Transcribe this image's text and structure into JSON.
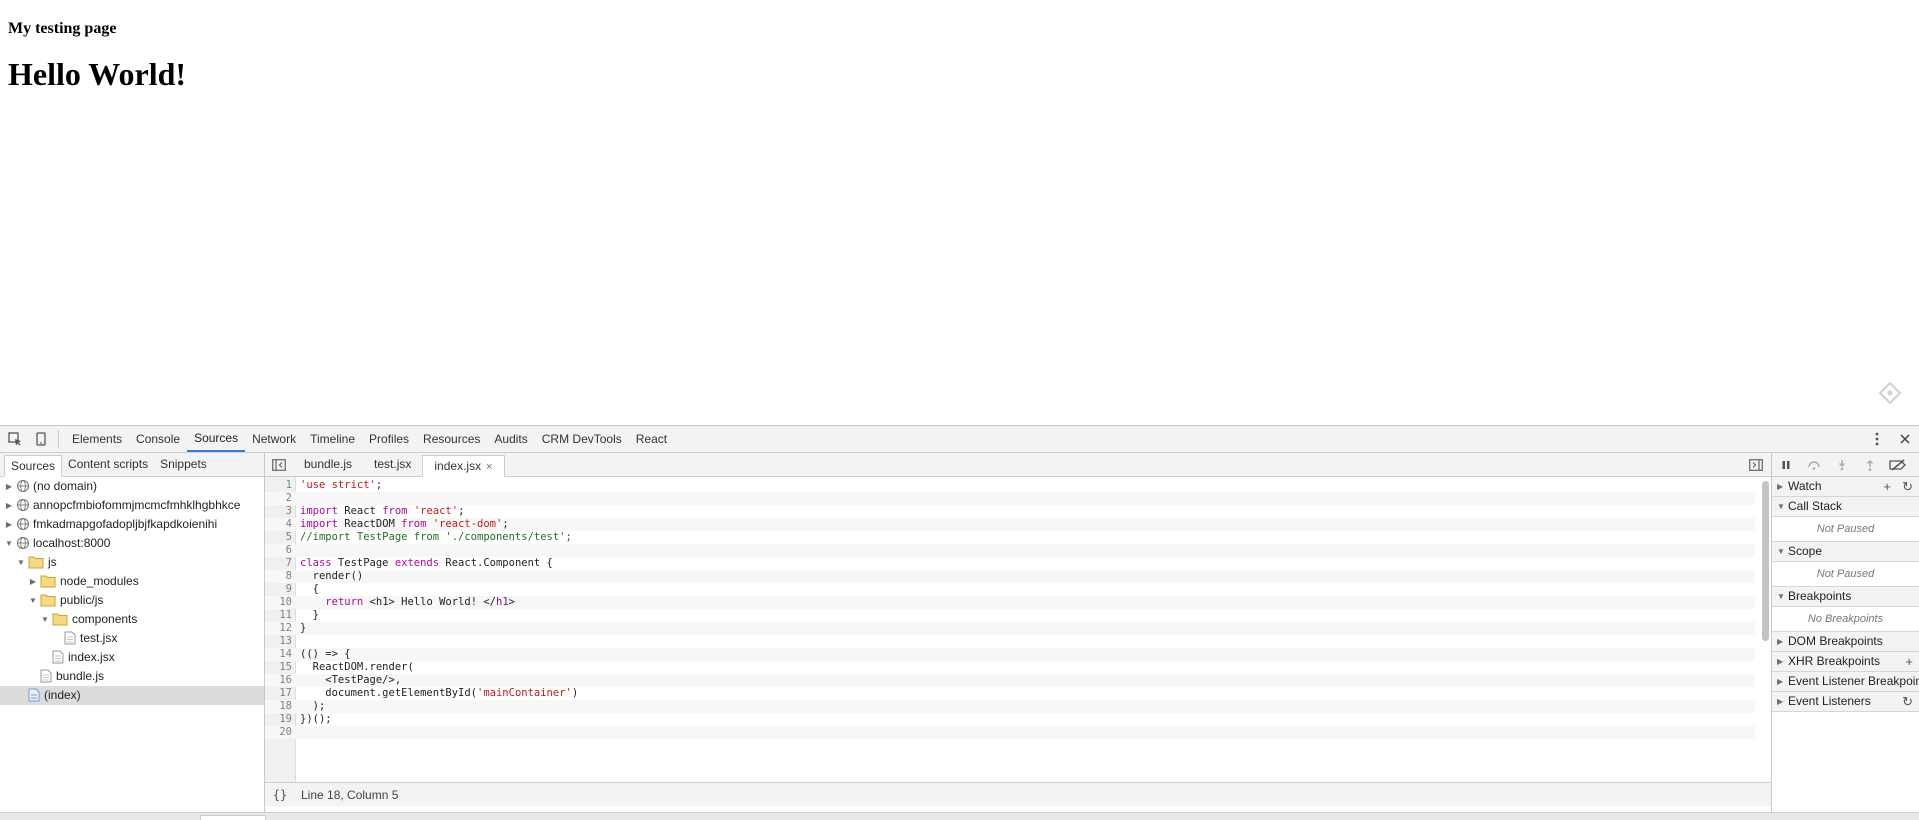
{
  "page": {
    "subtitle": "My testing page",
    "heading": "Hello World!"
  },
  "devtools": {
    "main_tabs": [
      "Elements",
      "Console",
      "Sources",
      "Network",
      "Timeline",
      "Profiles",
      "Resources",
      "Audits",
      "CRM DevTools",
      "React"
    ],
    "active_main_tab": "Sources",
    "navigator": {
      "tabs": [
        "Sources",
        "Content scripts",
        "Snippets"
      ],
      "active_tab": "Sources",
      "tree": [
        {
          "label": "(no domain)",
          "depth": 0,
          "type": "domain",
          "arrow": "right"
        },
        {
          "label": "annopcfmbiofommjmcmcfmhklhgbhkce",
          "depth": 0,
          "type": "domain",
          "arrow": "right"
        },
        {
          "label": "fmkadmapgofadopljbjfkapdkoienihi",
          "depth": 0,
          "type": "domain",
          "arrow": "right"
        },
        {
          "label": "localhost:8000",
          "depth": 0,
          "type": "domain",
          "arrow": "down"
        },
        {
          "label": "js",
          "depth": 1,
          "type": "folder",
          "arrow": "down"
        },
        {
          "label": "node_modules",
          "depth": 2,
          "type": "folder",
          "arrow": "right"
        },
        {
          "label": "public/js",
          "depth": 2,
          "type": "folder",
          "arrow": "down"
        },
        {
          "label": "components",
          "depth": 3,
          "type": "folder",
          "arrow": "down"
        },
        {
          "label": "test.jsx",
          "depth": 4,
          "type": "file",
          "arrow": ""
        },
        {
          "label": "index.jsx",
          "depth": 3,
          "type": "file",
          "arrow": ""
        },
        {
          "label": "bundle.js",
          "depth": 2,
          "type": "file",
          "arrow": ""
        },
        {
          "label": "(index)",
          "depth": 1,
          "type": "page",
          "arrow": "",
          "selected": true
        }
      ]
    },
    "editor": {
      "tabs": [
        "bundle.js",
        "test.jsx",
        "index.jsx"
      ],
      "active_tab": "index.jsx",
      "close_glyph": "×",
      "lines": [
        [
          [
            "str",
            "'use strict'"
          ],
          [
            "",
            ";"
          ]
        ],
        [],
        [
          [
            "kw",
            "import"
          ],
          [
            "",
            " React "
          ],
          [
            "kw",
            "from"
          ],
          [
            "",
            " "
          ],
          [
            "str",
            "'react'"
          ],
          [
            "",
            ";"
          ]
        ],
        [
          [
            "kw",
            "import"
          ],
          [
            "",
            " ReactDOM "
          ],
          [
            "kw",
            "from"
          ],
          [
            "",
            " "
          ],
          [
            "str",
            "'react-dom'"
          ],
          [
            "",
            ";"
          ]
        ],
        [
          [
            "cm",
            "//import TestPage from './components/test';"
          ]
        ],
        [],
        [
          [
            "kw",
            "class"
          ],
          [
            "",
            " TestPage "
          ],
          [
            "kw",
            "extends"
          ],
          [
            "",
            " React.Component {"
          ]
        ],
        [
          [
            "",
            "  render()"
          ]
        ],
        [
          [
            "",
            "  {"
          ]
        ],
        [
          [
            "",
            "    "
          ],
          [
            "kw",
            "return"
          ],
          [
            "",
            " <h1> Hello World! </"
          ],
          [
            "tag",
            "h1"
          ],
          [
            "",
            ">"
          ]
        ],
        [
          [
            "",
            "  }"
          ]
        ],
        [
          [
            "",
            "}"
          ]
        ],
        [],
        [
          [
            "",
            "(() => {"
          ]
        ],
        [
          [
            "",
            "  ReactDOM.render("
          ]
        ],
        [
          [
            "",
            "    <TestPage/>,"
          ]
        ],
        [
          [
            "",
            "    document.getElementById("
          ],
          [
            "str",
            "'mainContainer'"
          ],
          [
            "",
            ")"
          ]
        ],
        [
          [
            "",
            "  );"
          ]
        ],
        [
          [
            "",
            "})();"
          ]
        ],
        []
      ],
      "status": "Line 18, Column 5",
      "format_glyph": "{}"
    },
    "sidebar": {
      "panes": [
        {
          "title": "Watch",
          "expanded": false,
          "actions": [
            "+",
            "↻"
          ]
        },
        {
          "title": "Call Stack",
          "expanded": true,
          "body": "Not Paused"
        },
        {
          "title": "Scope",
          "expanded": true,
          "body": "Not Paused"
        },
        {
          "title": "Breakpoints",
          "expanded": true,
          "body": "No Breakpoints"
        },
        {
          "title": "DOM Breakpoints",
          "expanded": false
        },
        {
          "title": "XHR Breakpoints",
          "expanded": false,
          "actions": [
            "+"
          ]
        },
        {
          "title": "Event Listener Breakpoints",
          "expanded": false
        },
        {
          "title": "Event Listeners",
          "expanded": false,
          "actions": [
            "↻"
          ]
        }
      ]
    },
    "icons": {
      "inspect": "inspect-icon",
      "device": "device-mode-icon",
      "more": "more-vertical-icon",
      "close": "close-icon"
    }
  }
}
